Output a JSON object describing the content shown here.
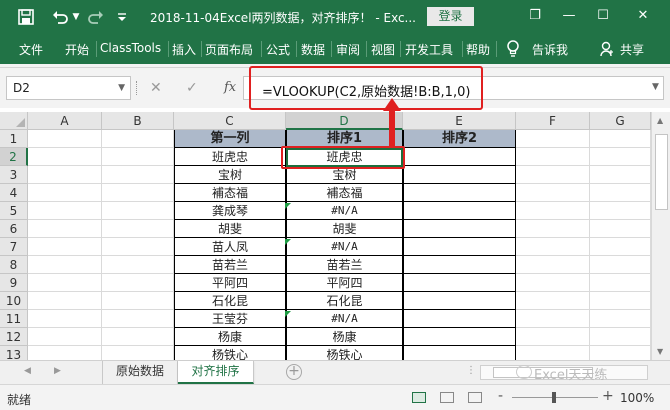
{
  "window": {
    "title": "2018-11-04Excel两列数据，对齐排序！ - Exc...",
    "login_label": "登录",
    "buttons": {
      "restore": "❐",
      "minimize": "—",
      "maximize": "☐",
      "close": "✕"
    }
  },
  "quick_access": {
    "save_icon": "save-icon",
    "undo_icon": "undo-icon",
    "redo_icon": "redo-icon"
  },
  "ribbon": {
    "tabs": [
      "文件",
      "开始",
      "ClassTools",
      "插入",
      "页面布局",
      "公式",
      "数据",
      "审阅",
      "视图",
      "开发工具",
      "帮助",
      "告诉我",
      "共享"
    ]
  },
  "formula_bar": {
    "name_box": "D2",
    "cancel": "✕",
    "enter": "✓",
    "fx": "fx",
    "formula": "=VLOOKUP(C2,原始数据!B:B,1,0)"
  },
  "grid": {
    "columns": [
      "A",
      "B",
      "C",
      "D",
      "E",
      "F",
      "G"
    ],
    "rows": [
      "1",
      "2",
      "3",
      "4",
      "5",
      "6",
      "7",
      "8",
      "9",
      "10",
      "11",
      "12",
      "13"
    ],
    "headers": {
      "c": "第一列",
      "d": "排序1",
      "e": "排序2"
    },
    "col_c": [
      "班虎忠",
      "宝树",
      "補态福",
      "龚成琴",
      "胡斐",
      "苗人凤",
      "苗若兰",
      "平阿四",
      "石化昆",
      "王莹芬",
      "杨康",
      "杨铁心"
    ],
    "col_d": [
      "班虎忠",
      "宝树",
      "補态福",
      "#N/A",
      "胡斐",
      "#N/A",
      "苗若兰",
      "平阿四",
      "石化昆",
      "#N/A",
      "杨康",
      "杨铁心"
    ],
    "active_cell": "D2"
  },
  "sheets": {
    "tabs": [
      "原始数据",
      "对齐排序"
    ],
    "active": "对齐排序",
    "add": "+"
  },
  "watermark": "Excel天天练",
  "status": {
    "text": "就绪",
    "zoom": "100%",
    "zoom_minus": "-",
    "zoom_plus": "+"
  },
  "colors": {
    "excel_green": "#217346",
    "header_fill": "#adb9ca",
    "highlight_red": "#e02020",
    "error_triangle": "#1e9c44"
  }
}
